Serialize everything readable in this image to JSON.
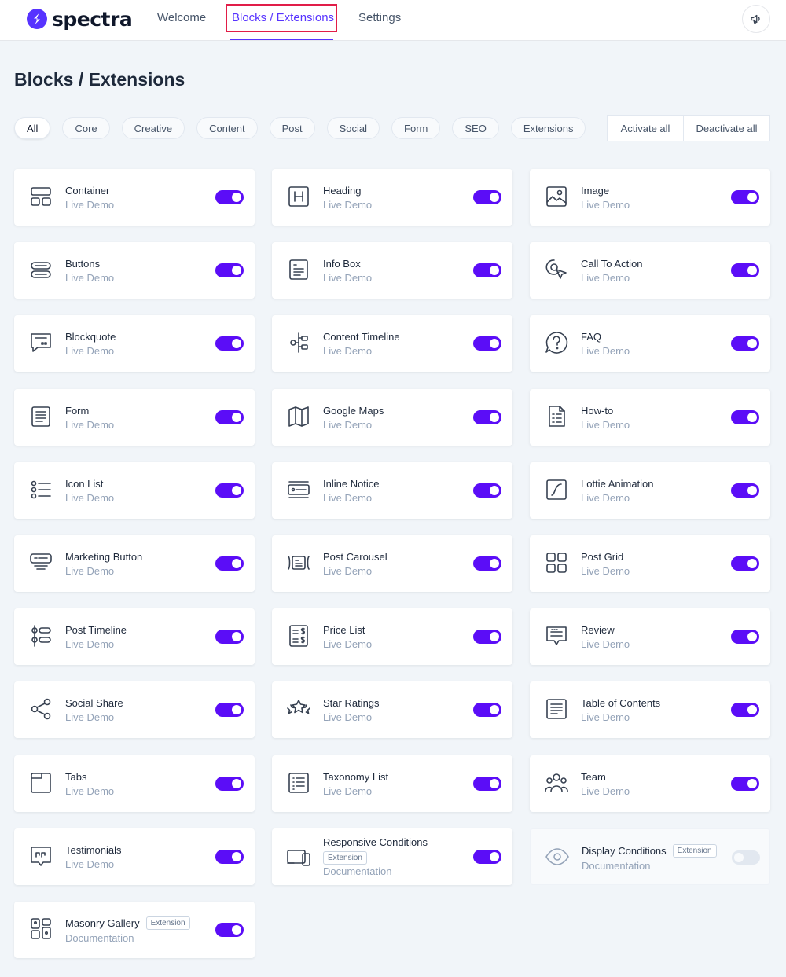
{
  "brand": {
    "name": "spectra",
    "color": "#5733ff"
  },
  "nav": {
    "welcome": "Welcome",
    "blocks": "Blocks / Extensions",
    "settings": "Settings",
    "announce_icon": "megaphone-icon"
  },
  "page": {
    "title": "Blocks / Extensions"
  },
  "filters": [
    "All",
    "Core",
    "Creative",
    "Content",
    "Post",
    "Social",
    "Form",
    "SEO",
    "Extensions"
  ],
  "active_filter": "All",
  "bulk": {
    "activate": "Activate all",
    "deactivate": "Deactivate all"
  },
  "colors": {
    "toggle_on": "#5b0df7",
    "toggle_off": "#e2e8f0"
  },
  "blocks": [
    {
      "title": "Container",
      "link": "Live Demo",
      "icon": "container",
      "enabled": true
    },
    {
      "title": "Heading",
      "link": "Live Demo",
      "icon": "heading",
      "enabled": true
    },
    {
      "title": "Image",
      "link": "Live Demo",
      "icon": "image",
      "enabled": true
    },
    {
      "title": "Buttons",
      "link": "Live Demo",
      "icon": "buttons",
      "enabled": true
    },
    {
      "title": "Info Box",
      "link": "Live Demo",
      "icon": "info-box",
      "enabled": true
    },
    {
      "title": "Call To Action",
      "link": "Live Demo",
      "icon": "call-to-action",
      "enabled": true
    },
    {
      "title": "Blockquote",
      "link": "Live Demo",
      "icon": "blockquote",
      "enabled": true
    },
    {
      "title": "Content Timeline",
      "link": "Live Demo",
      "icon": "content-timeline",
      "enabled": true
    },
    {
      "title": "FAQ",
      "link": "Live Demo",
      "icon": "faq",
      "enabled": true
    },
    {
      "title": "Form",
      "link": "Live Demo",
      "icon": "form",
      "enabled": true
    },
    {
      "title": "Google Maps",
      "link": "Live Demo",
      "icon": "google-maps",
      "enabled": true
    },
    {
      "title": "How-to",
      "link": "Live Demo",
      "icon": "how-to",
      "enabled": true
    },
    {
      "title": "Icon List",
      "link": "Live Demo",
      "icon": "icon-list",
      "enabled": true
    },
    {
      "title": "Inline Notice",
      "link": "Live Demo",
      "icon": "inline-notice",
      "enabled": true
    },
    {
      "title": "Lottie Animation",
      "link": "Live Demo",
      "icon": "lottie-animation",
      "enabled": true
    },
    {
      "title": "Marketing Button",
      "link": "Live Demo",
      "icon": "marketing-button",
      "enabled": true
    },
    {
      "title": "Post Carousel",
      "link": "Live Demo",
      "icon": "post-carousel",
      "enabled": true
    },
    {
      "title": "Post Grid",
      "link": "Live Demo",
      "icon": "post-grid",
      "enabled": true
    },
    {
      "title": "Post Timeline",
      "link": "Live Demo",
      "icon": "post-timeline",
      "enabled": true
    },
    {
      "title": "Price List",
      "link": "Live Demo",
      "icon": "price-list",
      "enabled": true
    },
    {
      "title": "Review",
      "link": "Live Demo",
      "icon": "review",
      "enabled": true
    },
    {
      "title": "Social Share",
      "link": "Live Demo",
      "icon": "social-share",
      "enabled": true
    },
    {
      "title": "Star Ratings",
      "link": "Live Demo",
      "icon": "star-ratings",
      "enabled": true
    },
    {
      "title": "Table of Contents",
      "link": "Live Demo",
      "icon": "table-of-contents",
      "enabled": true
    },
    {
      "title": "Tabs",
      "link": "Live Demo",
      "icon": "tabs",
      "enabled": true
    },
    {
      "title": "Taxonomy List",
      "link": "Live Demo",
      "icon": "taxonomy-list",
      "enabled": true
    },
    {
      "title": "Team",
      "link": "Live Demo",
      "icon": "team",
      "enabled": true
    },
    {
      "title": "Testimonials",
      "link": "Live Demo",
      "icon": "testimonials",
      "enabled": true
    },
    {
      "title": "Responsive Conditions",
      "link": "Documentation",
      "icon": "responsive-conditions",
      "enabled": true,
      "badge": "Extension",
      "badge_below": true
    },
    {
      "title": "Display Conditions",
      "link": "Documentation",
      "icon": "display-conditions",
      "enabled": false,
      "badge": "Extension"
    },
    {
      "title": "Masonry Gallery",
      "link": "Documentation",
      "icon": "masonry-gallery",
      "enabled": true,
      "badge": "Extension"
    }
  ]
}
